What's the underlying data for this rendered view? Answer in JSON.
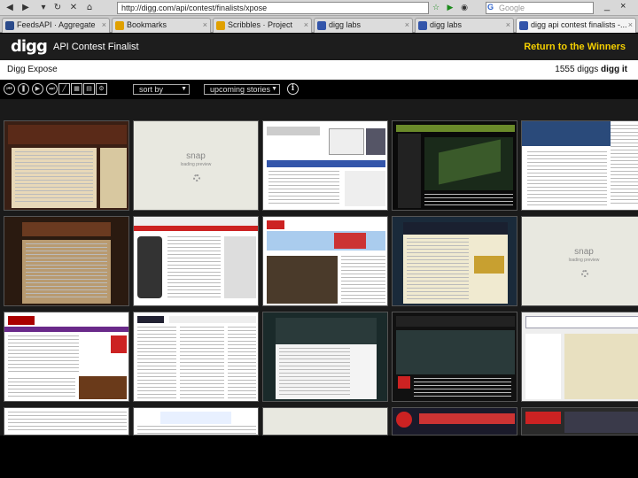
{
  "browser": {
    "url": "http://digg.com/api/contest/finalists/xpose",
    "search_placeholder": "Google",
    "win_min": "_",
    "win_restore": "×"
  },
  "tabs": [
    {
      "label": "FeedsAPI · Aggregate",
      "color": "#2a4a8a"
    },
    {
      "label": "Bookmarks",
      "color": "#e0a000"
    },
    {
      "label": "Scribbles · Project",
      "color": "#e0a000"
    },
    {
      "label": "digg labs",
      "color": "#3355aa"
    },
    {
      "label": "digg labs",
      "color": "#3355aa"
    },
    {
      "label": "digg api contest finalists -...",
      "color": "#3355aa"
    }
  ],
  "header": {
    "logo": "digg",
    "subtitle": "API Contest Finalist",
    "return_link": "Return to the Winners"
  },
  "ticker": {
    "left": "Digg Expose",
    "count": "1555 diggs",
    "digg_button": "digg it"
  },
  "controls": {
    "sort_label": "sort by",
    "stories_label": "upcoming stories"
  },
  "snap": {
    "logo": "snap",
    "tag": "loading preview"
  }
}
